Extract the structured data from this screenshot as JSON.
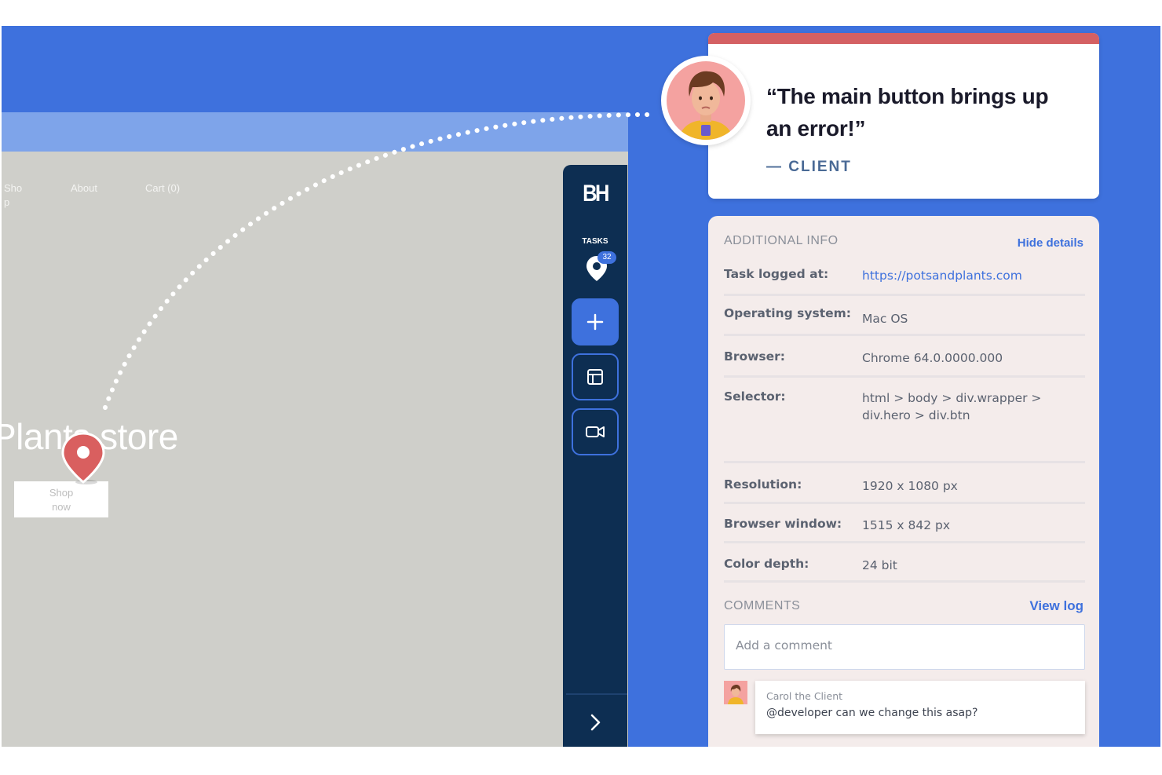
{
  "site": {
    "nav": [
      "Sho\np",
      "About",
      "Cart (0)"
    ],
    "hero_title": "Plants store",
    "cta_label": "Shop\nnow"
  },
  "sidebar": {
    "logo": "BH",
    "tasks_label": "TASKS",
    "tasks_count": "32",
    "icons": [
      "map-pin-icon",
      "plus-icon",
      "layout-icon",
      "video-icon",
      "chevron-right-icon"
    ]
  },
  "quote": {
    "text": "“The main button brings up an error!”",
    "attribution": "— CLIENT"
  },
  "details": {
    "title": "ADDITIONAL INFO",
    "hide_label": "Hide details",
    "rows": [
      {
        "label": "Task logged at:",
        "value": "https://potsandplants.com"
      },
      {
        "label": "Operating system:",
        "value": "Mac OS"
      },
      {
        "label": "Browser:",
        "value": "Chrome 64.0.0000.000"
      },
      {
        "label": "Selector:",
        "value": "html > body > div.wrapper > div.hero > div.btn"
      },
      {
        "label": "Resolution:",
        "value": "1920 x 1080 px"
      },
      {
        "label": "Browser window:",
        "value": "1515 x 842 px"
      },
      {
        "label": "Color depth:",
        "value": "24 bit"
      }
    ]
  },
  "comments": {
    "title": "COMMENTS",
    "view_log_label": "View log",
    "input_placeholder": "Add a comment",
    "items": [
      {
        "author": "Carol the Client",
        "text": "@developer can we change this asap?"
      }
    ]
  },
  "colors": {
    "background": "#3e71dd",
    "sidebar": "#0d2e52",
    "accent": "#3e71dd",
    "alert": "#d46063",
    "panel": "#f4eceb"
  }
}
